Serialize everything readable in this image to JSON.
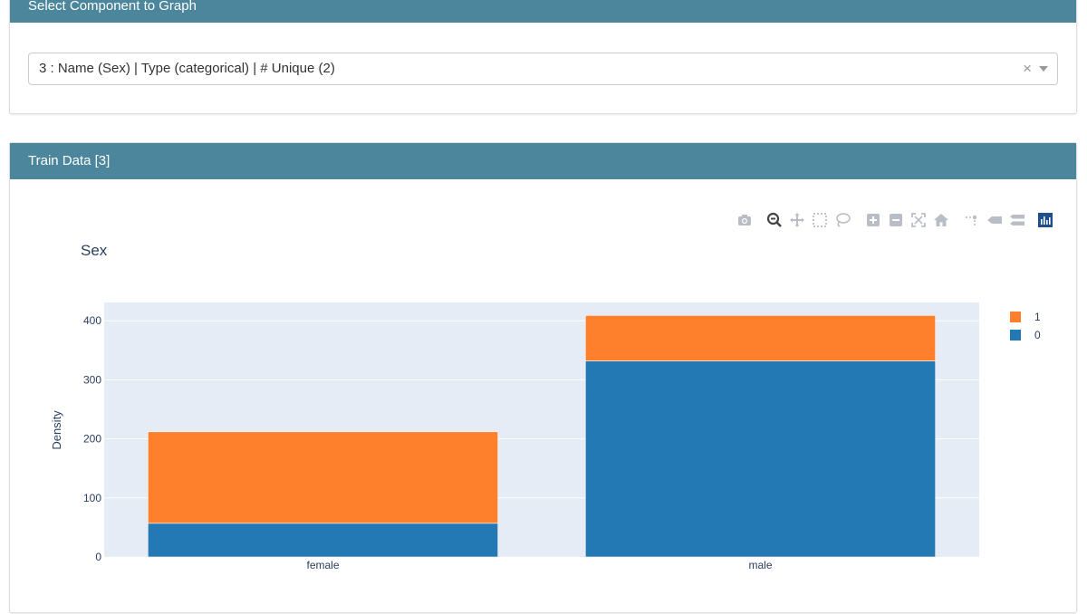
{
  "select_card": {
    "title": "Select Component to Graph",
    "selected_value": "3 : Name (Sex) | Type (categorical) | # Unique (2)",
    "clear_glyph": "×"
  },
  "train_card": {
    "title": "Train Data [3]"
  },
  "modebar": {
    "icons": [
      "camera-icon",
      "zoom-icon",
      "pan-icon",
      "box-select-icon",
      "lasso-select-icon",
      "zoom-in-icon",
      "zoom-out-icon",
      "autoscale-icon",
      "reset-axes-icon",
      "spike-lines-icon",
      "hover-closest-icon",
      "hover-compare-icon",
      "plotly-logo-icon"
    ]
  },
  "chart_data": {
    "type": "bar",
    "barmode": "stack",
    "title": "Sex",
    "xlabel": "",
    "ylabel": "Density",
    "categories": [
      "female",
      "male"
    ],
    "series": [
      {
        "name": "0",
        "values": [
          57,
          332
        ],
        "color": "#2279b4"
      },
      {
        "name": "1",
        "values": [
          155,
          77
        ],
        "color": "#fe7f2c"
      }
    ],
    "ylim": [
      0,
      431
    ],
    "yticks": [
      0,
      100,
      200,
      300,
      400
    ],
    "legend_position": "top-right",
    "grid": true,
    "plot_bg": "#e5ecf6"
  }
}
